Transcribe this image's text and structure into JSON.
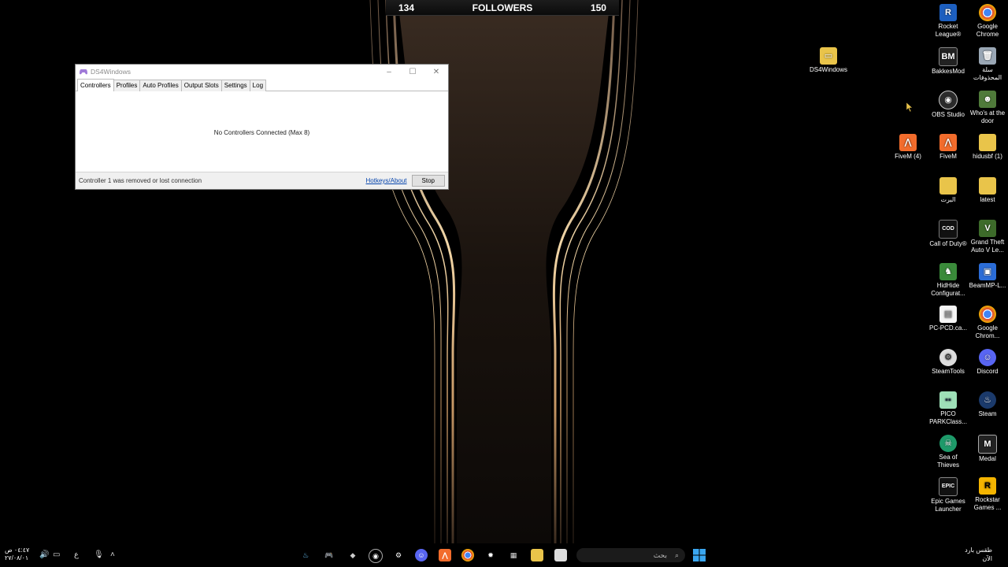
{
  "banner": {
    "left_count": "134",
    "title": "FOLLOWERS",
    "right_count": "150"
  },
  "window": {
    "title": "DS4Windows",
    "controls": [
      "–",
      "☐",
      "✕"
    ],
    "tabs": [
      "Controllers",
      "Profiles",
      "Auto Profiles",
      "Output Slots",
      "Settings",
      "Log"
    ],
    "active_tab": "Controllers",
    "message": "No Controllers Connected (Max 8)",
    "status": "Controller 1 was removed or lost connection",
    "hotkeys_link": "Hotkeys/About",
    "stop_button": "Stop"
  },
  "desktop_icons": {
    "ds4windows": "DS4Windows",
    "rocket_league": "Rocket League®",
    "google_chrome": "Google Chrome",
    "bakkesmod": "BakkesMod",
    "recycle_bin": "سلة المحذوفات",
    "obs_studio": "OBS Studio",
    "whos_at_door": "Who's at the door",
    "fivem_4": "FiveM (4)",
    "fivem": "FiveM",
    "hidusbf": "hidusbf (1)",
    "folder_arabic": "البرت",
    "latest": "latest",
    "call_of_duty": "Call of Duty®",
    "gta_v": "Grand Theft Auto V Le...",
    "hidhide": "HidHide Configurat...",
    "beammp": "BeamMP-L...",
    "pc_pcd": "PC-PCD.ca...",
    "google_chrome_2": "Google Chrom...",
    "steamtools": "SteamTools",
    "discord": "Discord",
    "pico_park": "PICO PARKClass...",
    "steam": "Steam",
    "sea_of_thieves": "Sea of Thieves",
    "medal": "Medal",
    "epic_games": "Epic Games Launcher",
    "rockstar": "Rockstar Games ..."
  },
  "taskbar": {
    "time": "٠٤:٤٧ ص",
    "date": "٢٧/٠٨/٠١",
    "language": "ع",
    "search_placeholder": "بحث",
    "weather_line1": "طقس بارد",
    "weather_line2": "الآن"
  },
  "colors": {
    "window_bg": "#ffffff",
    "link": "#0645ad",
    "taskbar_bg": "#000000",
    "wallpaper_glow": "#d9b37c"
  }
}
